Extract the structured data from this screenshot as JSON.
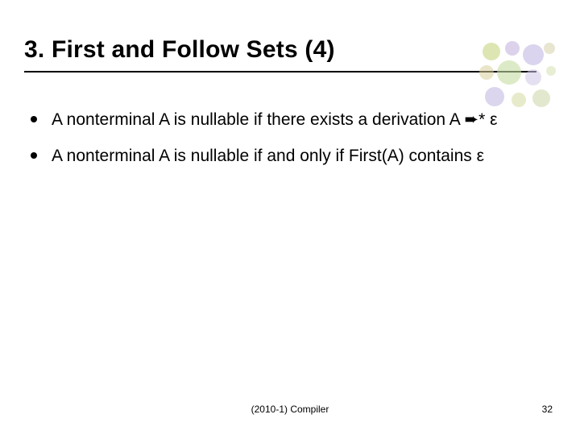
{
  "title": "3. First and Follow Sets (4)",
  "bullets": [
    "A nonterminal A is nullable if there exists a derivation A ➨* ε",
    "A nonterminal A is nullable if and only if First(A) contains ε"
  ],
  "footer_center": "(2010-1) Compiler",
  "footer_right": "32"
}
